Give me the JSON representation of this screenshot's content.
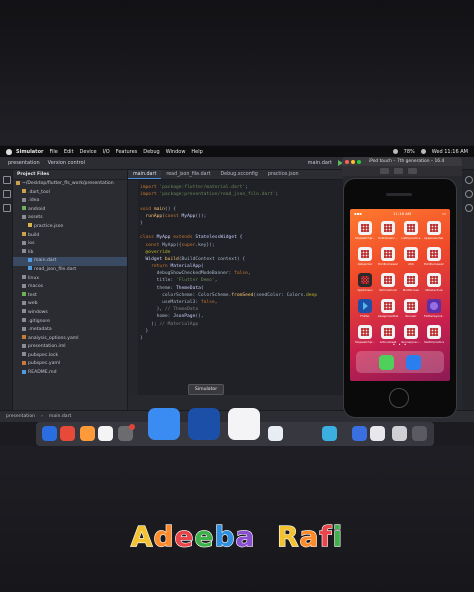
{
  "menubar": {
    "app_name": "Simulator",
    "items": [
      "File",
      "Edit",
      "Device",
      "I/O",
      "Features",
      "Debug",
      "Window",
      "Help"
    ],
    "battery": "78%",
    "clock": "Wed 11:16 AM"
  },
  "toolbar": {
    "project": "presentation",
    "vcs": "Version control",
    "run_config": "main.dart"
  },
  "project_panel": {
    "title": "Project Files",
    "items": [
      {
        "label": "~/Desktop/flutter_fls_work/presentation",
        "indent": 0,
        "color": "#c8a24a"
      },
      {
        "label": ".dart_tool",
        "indent": 1,
        "color": "#c8a24a"
      },
      {
        "label": ".idea",
        "indent": 1,
        "color": "#8a8d94"
      },
      {
        "label": "android",
        "indent": 1,
        "color": "#6fb05a"
      },
      {
        "label": "assets",
        "indent": 1,
        "color": "#8a8d94"
      },
      {
        "label": "practice.json",
        "indent": 2,
        "color": "#d6b44a"
      },
      {
        "label": "build",
        "indent": 1,
        "color": "#c8a24a"
      },
      {
        "label": "ios",
        "indent": 1,
        "color": "#8a8d94"
      },
      {
        "label": "lib",
        "indent": 1,
        "color": "#8a8d94"
      },
      {
        "label": "main.dart",
        "indent": 2,
        "color": "#4e9be0",
        "selected": true
      },
      {
        "label": "read_json_file.dart",
        "indent": 2,
        "color": "#4e9be0"
      },
      {
        "label": "linux",
        "indent": 1,
        "color": "#8a8d94"
      },
      {
        "label": "macos",
        "indent": 1,
        "color": "#8a8d94"
      },
      {
        "label": "test",
        "indent": 1,
        "color": "#6fb05a"
      },
      {
        "label": "web",
        "indent": 1,
        "color": "#8a8d94"
      },
      {
        "label": "windows",
        "indent": 1,
        "color": "#8a8d94"
      },
      {
        "label": ".gitignore",
        "indent": 1,
        "color": "#8a8d94"
      },
      {
        "label": ".metadata",
        "indent": 1,
        "color": "#8a8d94"
      },
      {
        "label": "analysis_options.yaml",
        "indent": 1,
        "color": "#c77a3a"
      },
      {
        "label": "presentation.iml",
        "indent": 1,
        "color": "#8a8d94"
      },
      {
        "label": "pubspec.lock",
        "indent": 1,
        "color": "#8a8d94"
      },
      {
        "label": "pubspec.yaml",
        "indent": 1,
        "color": "#c77a3a"
      },
      {
        "label": "README.md",
        "indent": 1,
        "color": "#4e9be0"
      }
    ]
  },
  "tabs": [
    {
      "label": "main.dart",
      "active": true
    },
    {
      "label": "read_json_file.dart",
      "active": false
    },
    {
      "label": "Debug.xcconfig",
      "active": false
    },
    {
      "label": "practice.json",
      "active": false
    }
  ],
  "code_lines": [
    [
      {
        "t": "import ",
        "c": "kw"
      },
      {
        "t": "'package:flutter/material.dart'",
        "c": "str"
      },
      {
        "t": ";",
        "c": "pl"
      }
    ],
    [
      {
        "t": "import ",
        "c": "kw"
      },
      {
        "t": "'package:presentation/read_json_file.dart'",
        "c": "str"
      },
      {
        "t": ";",
        "c": "pl"
      }
    ],
    [],
    [
      {
        "t": "void ",
        "c": "kw"
      },
      {
        "t": "main",
        "c": "fn"
      },
      {
        "t": "() {",
        "c": "pl"
      }
    ],
    [
      {
        "t": "  runApp",
        "c": "fn"
      },
      {
        "t": "(",
        "c": "pl"
      },
      {
        "t": "const ",
        "c": "kw"
      },
      {
        "t": "MyApp",
        "c": "cls"
      },
      {
        "t": "());",
        "c": "pl"
      }
    ],
    [
      {
        "t": "}",
        "c": "pl"
      }
    ],
    [],
    [
      {
        "t": "class ",
        "c": "kw"
      },
      {
        "t": "MyApp ",
        "c": "cls"
      },
      {
        "t": "extends ",
        "c": "kw"
      },
      {
        "t": "StatelessWidget {",
        "c": "cls"
      }
    ],
    [
      {
        "t": "  const ",
        "c": "kw"
      },
      {
        "t": "MyApp({",
        "c": "pl"
      },
      {
        "t": "super",
        "c": "kw"
      },
      {
        "t": ".key});",
        "c": "pl"
      }
    ],
    [
      {
        "t": "  @override",
        "c": "an"
      }
    ],
    [
      {
        "t": "  Widget ",
        "c": "cls"
      },
      {
        "t": "build",
        "c": "fn"
      },
      {
        "t": "(BuildContext context) {",
        "c": "pl"
      }
    ],
    [
      {
        "t": "    return ",
        "c": "kw"
      },
      {
        "t": "MaterialApp(",
        "c": "cls"
      }
    ],
    [
      {
        "t": "      debugShowCheckedModeBanner: ",
        "c": "pl"
      },
      {
        "t": "false",
        "c": "bool"
      },
      {
        "t": ",",
        "c": "pl"
      }
    ],
    [
      {
        "t": "      title: ",
        "c": "pl"
      },
      {
        "t": "'Flutter Demo'",
        "c": "str"
      },
      {
        "t": ",",
        "c": "pl"
      }
    ],
    [
      {
        "t": "      theme: ",
        "c": "pl"
      },
      {
        "t": "ThemeData(",
        "c": "cls"
      }
    ],
    [
      {
        "t": "        colorScheme: ColorScheme.",
        "c": "pl"
      },
      {
        "t": "fromSeed",
        "c": "fn"
      },
      {
        "t": "(seedColor: Colors.",
        "c": "pl"
      },
      {
        "t": "deep",
        "c": "an"
      }
    ],
    [
      {
        "t": "        useMaterial3: ",
        "c": "pl"
      },
      {
        "t": "false",
        "c": "bool"
      },
      {
        "t": ",",
        "c": "pl"
      }
    ],
    [
      {
        "t": "      ), ",
        "c": "pl"
      },
      {
        "t": "// ThemeData",
        "c": "cm"
      }
    ],
    [
      {
        "t": "      home: ",
        "c": "pl"
      },
      {
        "t": "JsonPage",
        "c": "cls"
      },
      {
        "t": "(),",
        "c": "pl"
      }
    ],
    [
      {
        "t": "    ); ",
        "c": "pl"
      },
      {
        "t": "// MaterialApp",
        "c": "cm"
      }
    ],
    [
      {
        "t": "  }",
        "c": "pl"
      }
    ],
    [
      {
        "t": "}",
        "c": "pl"
      }
    ],
    []
  ],
  "simulator": {
    "title": "iPod touch – 7th generation – 16.4",
    "clock": "11:16 AM",
    "apps": [
      "Stopwatchpr…",
      "Pullrefreshc…",
      "Listfopractice",
      "Appscreenhel…",
      "datepicker",
      "thirdhomework…",
      "Ahb",
      "thirdhomework…",
      "AppScreen",
      "VerticalClock",
      "MultiScreen",
      "NoteLecture",
      "Flutter",
      "Assignmentlab…",
      "Runnerr",
      "Flutterlayout…",
      "Stopwatchpr…",
      "Actionsheet",
      "Runnerprac…",
      "Switchpractice"
    ],
    "app_styles": [
      "",
      "",
      "",
      "",
      "",
      "",
      "",
      "",
      "dark",
      "",
      "",
      "",
      "flutter",
      "",
      "",
      "purple",
      "",
      "",
      "",
      ""
    ],
    "page_dots": "• • •"
  },
  "statusbar": {
    "breadcrumb": "presentation",
    "file": "main.dart"
  },
  "tooltip": "Simulator",
  "dock_colors": [
    "#2a6de0",
    "#e84a3a",
    "#ff9a3a",
    "#f4f4f4",
    "#6b6b70",
    "#3b8cf2",
    "#1b4fa8",
    "#f4f4f6",
    "#e8ecf4",
    "#3bb0e0",
    "#3a6fe0",
    "#e8e8ec",
    "#d0d0d4",
    "#5a5a60"
  ],
  "signature": {
    "text": "Adeeba Rafi"
  }
}
